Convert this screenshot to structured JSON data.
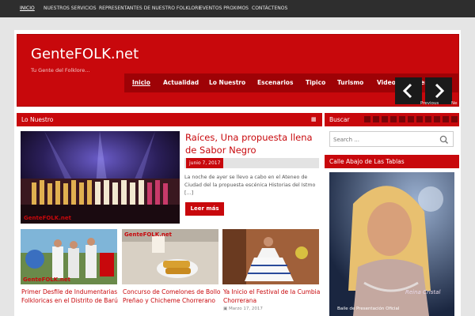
{
  "topnav": {
    "items": [
      "INICIO",
      "NUESTROS SERVICIOS",
      "REPRESENTANTES DE NUESTRO FOLKLORE",
      "EVENTOS PROXIMOS",
      "CONTÁCTENOS"
    ]
  },
  "site": {
    "title": "GenteFOLK.net",
    "tagline": "Tu Gente del Folklore..."
  },
  "menu": {
    "items": [
      "Inicio",
      "Actualidad",
      "Lo Nuestro",
      "Escenarios",
      "Tipico",
      "Turismo",
      "Videos",
      "Eventos"
    ]
  },
  "slider": {
    "prev_label": "Previous",
    "next_label": "Ne"
  },
  "section": {
    "title": "Lo Nuestro"
  },
  "featured": {
    "title": "Raíces, Una propuesta llena de Sabor Negro",
    "date": "junio 7, 2017",
    "excerpt": "La noche de ayer se llevo a cabo en el Ateneo de Ciudad del la propuesta escénica Historias del Istmo […]",
    "read_more": "Leer más",
    "watermark": "GenteFOLK.net"
  },
  "posts": [
    {
      "title": "Primer Desfile de Indumentarias Folkloricas en el Distrito de Barú",
      "date": ""
    },
    {
      "title": "Concurso de Comelones de Bollo Preñao y Chicheme Chorrerano",
      "date": ""
    },
    {
      "title": "Ya Inicio el Festival de la Cumbia Chorrerana",
      "date": "Marzo 17, 2017"
    }
  ],
  "sidebar": {
    "search_title": "Buscar",
    "search_placeholder": "Search ...",
    "ad_title": "Calle Abajo de Las Tablas",
    "ad_caption": "Baile de Presentación Oficial",
    "ad_signature": "Reina Cristal"
  },
  "colors": {
    "brand_red": "#c8080c",
    "dark_red": "#9e0206",
    "topbar": "#2e2e2e"
  }
}
